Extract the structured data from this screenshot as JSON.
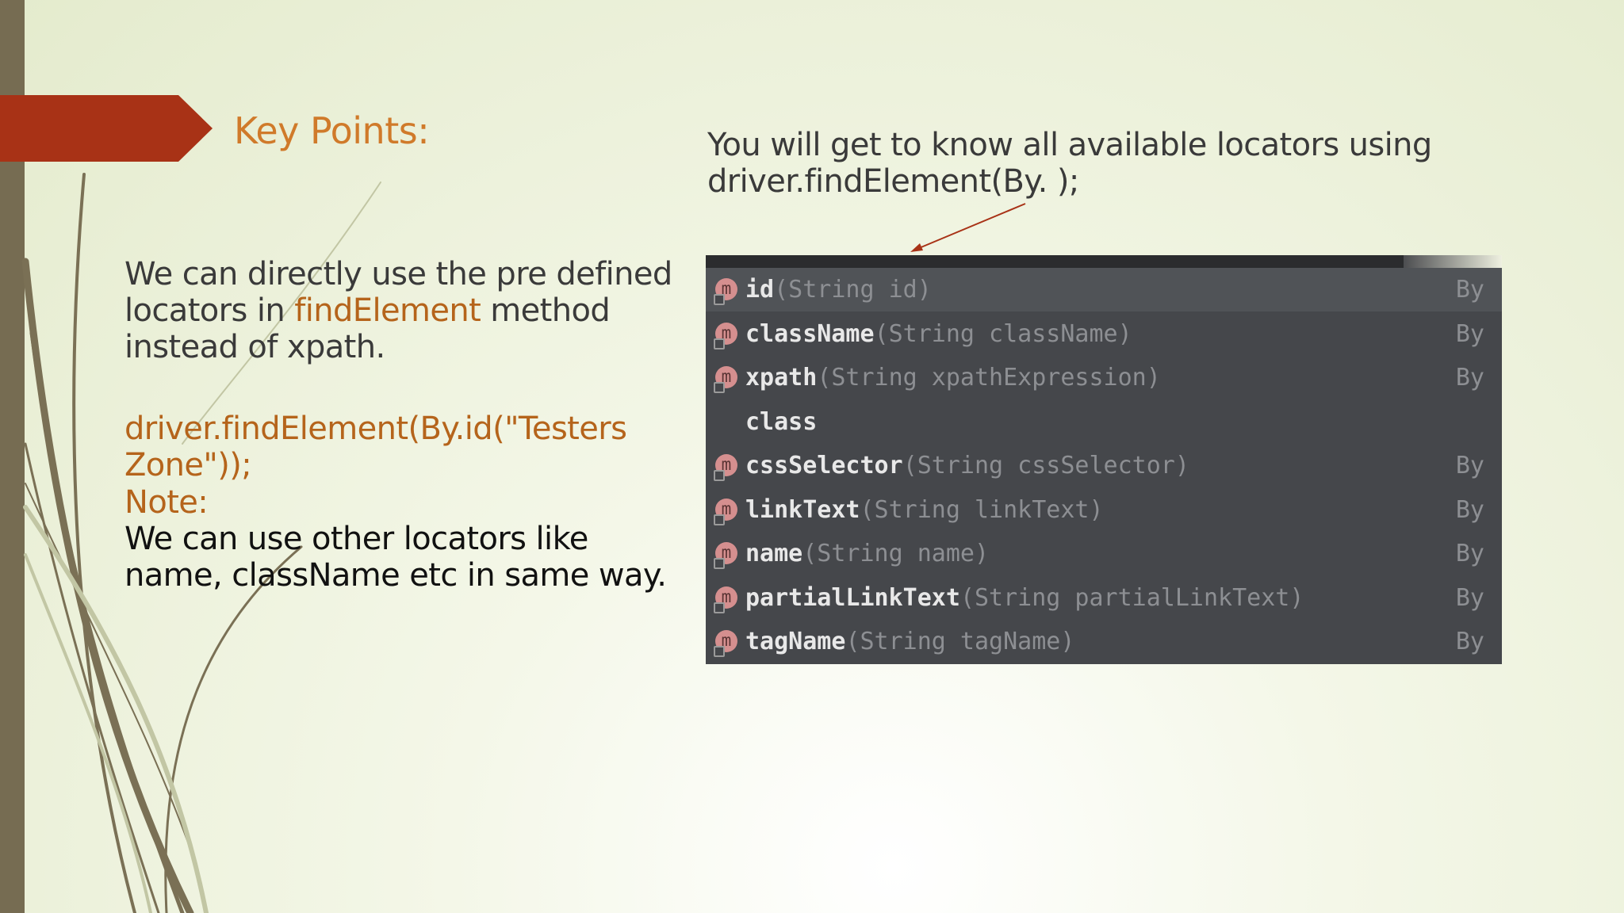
{
  "slide": {
    "title": "Key Points:",
    "para1": {
      "before": "We can directly use the pre defined locators in ",
      "highlight": "findElement",
      "after": " method instead of xpath."
    },
    "code_example": "driver.findElement(By.id(\"Testers Zone\"));",
    "note_label": "Note:",
    "note_text": "We can use other locators like name, className etc in same way.",
    "right_caption": "You will get to know all available locators using driver.findElement(By. );"
  },
  "autocomplete": {
    "icon_letter": "m",
    "items": [
      {
        "method": "id",
        "signature": "(String id)",
        "return_type": "By",
        "icon": "method-icon"
      },
      {
        "method": "className",
        "signature": "(String className)",
        "return_type": "By",
        "icon": "method-icon"
      },
      {
        "method": "xpath",
        "signature": "(String xpathExpression)",
        "return_type": "By",
        "icon": "method-icon"
      },
      {
        "method": "class",
        "signature": "",
        "return_type": "",
        "icon": ""
      },
      {
        "method": "cssSelector",
        "signature": "(String cssSelector)",
        "return_type": "By",
        "icon": "method-icon"
      },
      {
        "method": "linkText",
        "signature": "(String linkText)",
        "return_type": "By",
        "icon": "method-icon"
      },
      {
        "method": "name",
        "signature": "(String name)",
        "return_type": "By",
        "icon": "method-icon"
      },
      {
        "method": "partialLinkText",
        "signature": "(String partialLinkText)",
        "return_type": "By",
        "icon": "method-icon"
      },
      {
        "method": "tagName",
        "signature": "(String tagName)",
        "return_type": "By",
        "icon": "method-icon"
      }
    ]
  },
  "colors": {
    "accent_orange": "#d07a2a",
    "banner_red": "#a83216",
    "left_bar": "#766c52",
    "popup_bg": "#45474b"
  }
}
